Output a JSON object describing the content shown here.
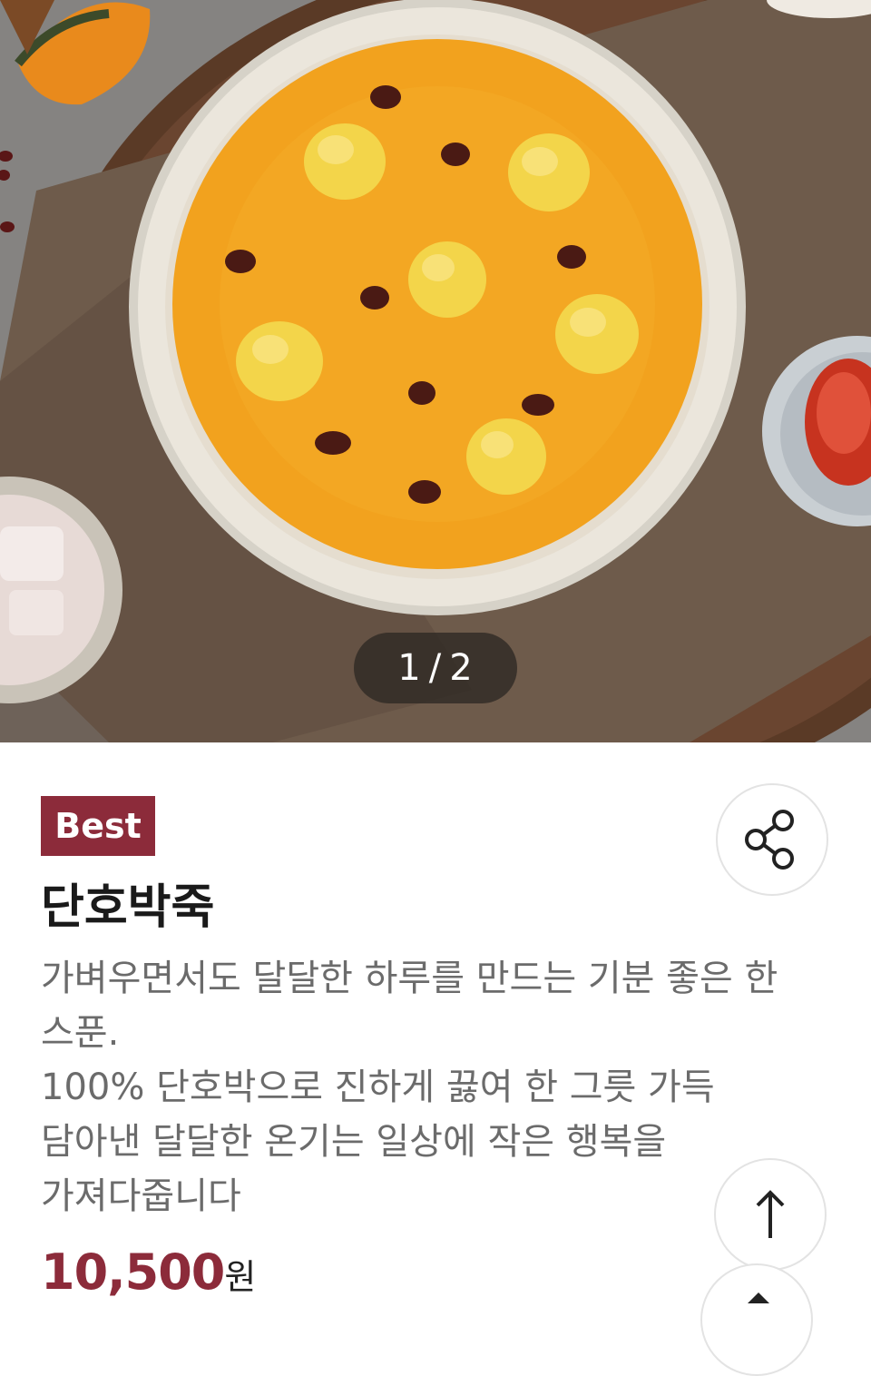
{
  "hero": {
    "pager": {
      "current": "1",
      "separator": "/",
      "total": "2"
    }
  },
  "product": {
    "badge": "Best",
    "title": "단호박죽",
    "description_lines": [
      "가벼우면서도 달달한 하루를 만드는 기분 좋은 한",
      "스푼.",
      "100% 단호박으로 진하게 끓여 한 그릇 가득",
      "담아낸 달달한 온기는 일상에 작은 행복을",
      "가져다줍니다"
    ],
    "price": "10,500",
    "price_unit": "원"
  },
  "icons": {
    "share": "share-icon",
    "scroll_top": "arrow-up-icon",
    "extra": "chevron-up-icon"
  },
  "colors": {
    "accent": "#8c2b3a",
    "soup": "#f2a21e"
  }
}
